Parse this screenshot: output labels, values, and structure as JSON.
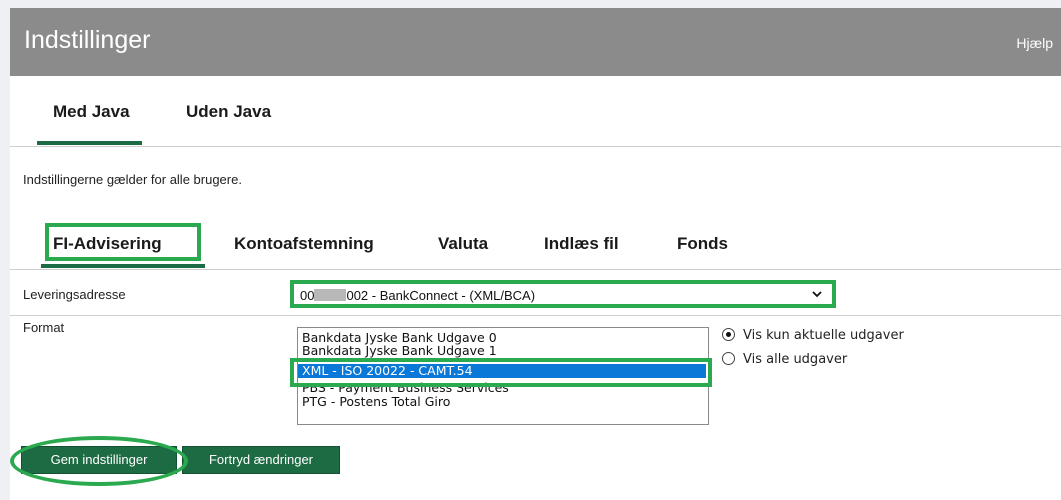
{
  "window": {
    "title": "Indstillinger",
    "help_label": "Hjælp"
  },
  "top_tabs": [
    {
      "label": "Med Java",
      "active": true
    },
    {
      "label": "Uden Java",
      "active": false
    }
  ],
  "note": "Indstillingerne gælder for alle brugere.",
  "sub_tabs": [
    {
      "label": "FI-Advisering",
      "active": true
    },
    {
      "label": "Kontoafstemning",
      "active": false
    },
    {
      "label": "Valuta",
      "active": false
    },
    {
      "label": "Indlæs fil",
      "active": false
    },
    {
      "label": "Fonds",
      "active": false
    }
  ],
  "delivery": {
    "label": "Leveringsadresse",
    "value_prefix": "00",
    "value_suffix": "002 - BankConnect - (XML/BCA)"
  },
  "format": {
    "label": "Format",
    "options": [
      "Bankdata Jyske Bank Udgave 0",
      "Bankdata Jyske Bank Udgave 1",
      "XML - ISO 20022 - CAMT.54",
      "PBS - Payment Business Services",
      "PTG - Postens Total Giro"
    ],
    "selected_index": 2
  },
  "radios": [
    {
      "label": "Vis kun aktuelle udgaver",
      "checked": true
    },
    {
      "label": "Vis alle udgaver",
      "checked": false
    }
  ],
  "buttons": {
    "save": "Gem indstillinger",
    "cancel": "Fortryd ændringer"
  },
  "colors": {
    "accent_green": "#1c6b43",
    "highlight_green": "#2aa94f",
    "title_bar": "#8b8b8b",
    "selection_blue": "#0a78d7"
  }
}
